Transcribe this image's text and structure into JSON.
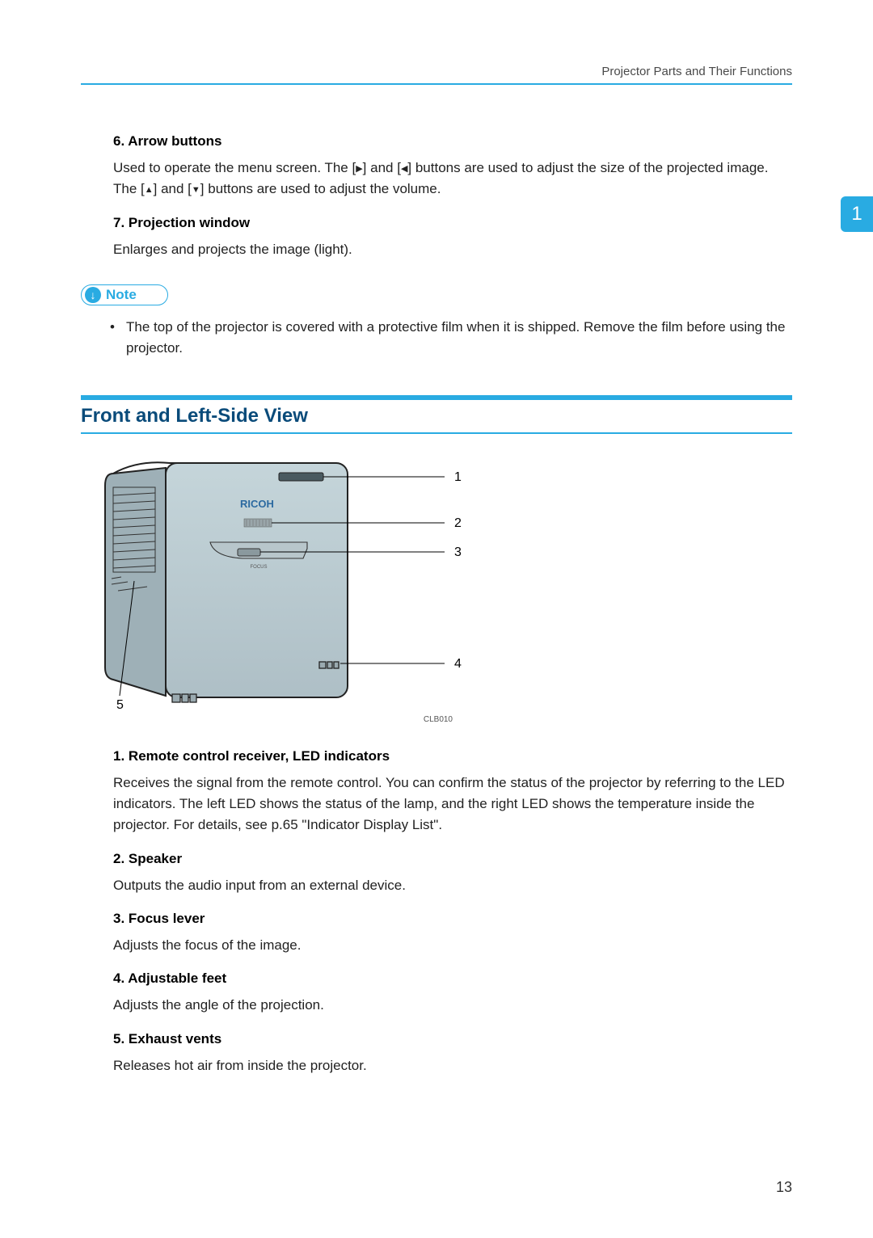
{
  "header": {
    "running_title": "Projector Parts and Their Functions",
    "chapter_number": "1",
    "page_number": "13"
  },
  "top_items": [
    {
      "number": "6.",
      "label": "Arrow buttons",
      "desc_parts": [
        "Used to operate the menu screen. The [",
        "▶",
        "] and [",
        "◀",
        "] buttons are used to adjust the size of the projected image. The [",
        "▲",
        "] and [",
        "▼",
        "] buttons are used to adjust the volume."
      ]
    },
    {
      "number": "7.",
      "label": "Projection window",
      "desc": "Enlarges and projects the image (light)."
    }
  ],
  "note": {
    "badge": "Note",
    "text": "The top of the projector is covered with a protective film when it is shipped. Remove the film before using the projector."
  },
  "section_title": "Front and Left-Side View",
  "figure": {
    "brand": "RICOH",
    "focus_label": "FOCUS",
    "callouts": [
      "1",
      "2",
      "3",
      "4",
      "5"
    ],
    "code": "CLB010"
  },
  "items": [
    {
      "number": "1.",
      "label": "Remote control receiver, LED indicators",
      "desc": "Receives the signal from the remote control. You can confirm the status of the projector by referring to the LED indicators. The left LED shows the status of the lamp, and the right LED shows the temperature inside the projector. For details, see p.65 \"Indicator Display List\"."
    },
    {
      "number": "2.",
      "label": "Speaker",
      "desc": "Outputs the audio input from an external device."
    },
    {
      "number": "3.",
      "label": "Focus lever",
      "desc": "Adjusts the focus of the image."
    },
    {
      "number": "4.",
      "label": "Adjustable feet",
      "desc": "Adjusts the angle of the projection."
    },
    {
      "number": "5.",
      "label": "Exhaust vents",
      "desc": "Releases hot air from inside the projector."
    }
  ]
}
